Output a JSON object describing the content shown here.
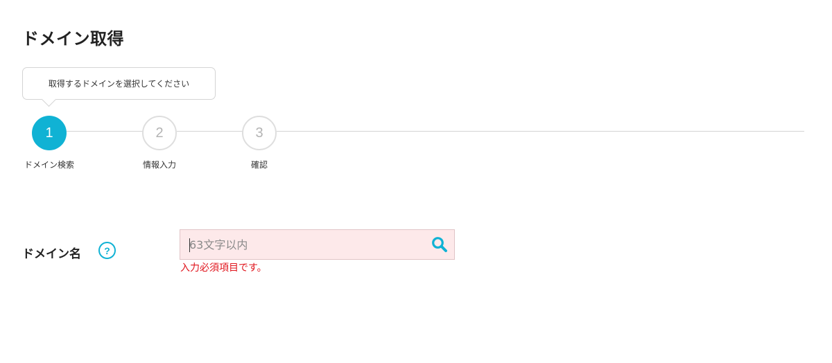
{
  "page": {
    "title": "ドメイン取得"
  },
  "tooltip": {
    "text": "取得するドメインを選択してください"
  },
  "steps": [
    {
      "number": "1",
      "label": "ドメイン検索",
      "state": "active"
    },
    {
      "number": "2",
      "label": "情報入力",
      "state": "inactive"
    },
    {
      "number": "3",
      "label": "確認",
      "state": "inactive"
    }
  ],
  "form": {
    "domain_label": "ドメイン名",
    "help_icon_glyph": "?",
    "domain_input": {
      "value": "",
      "placeholder": "63文字以内"
    },
    "error_message": "入力必須項目です。"
  },
  "colors": {
    "accent": "#10b2d4",
    "error": "#e0141c",
    "input_error_bg": "#fde9ea"
  },
  "icons": {
    "search": "search-icon",
    "help": "question-circle-icon"
  }
}
